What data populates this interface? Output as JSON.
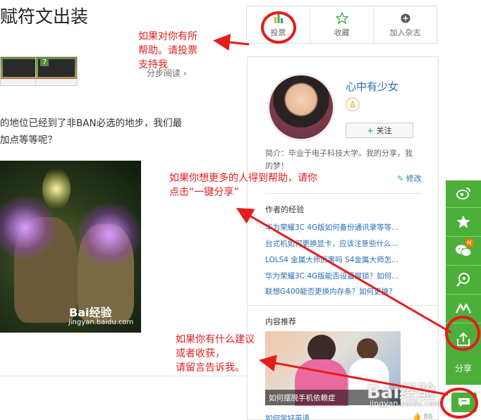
{
  "article": {
    "title": "赋符文出装",
    "step_read": "分步阅读 ›",
    "para1": "的地位已经到了非BAN必选的地步，我们最",
    "para2": "加点等等呢？",
    "thumb2_num": "7",
    "image_watermark": "Bai经验",
    "image_watermark_url": "jingyan.baidu.com"
  },
  "actions": {
    "vote": "投票",
    "favorite": "收藏",
    "add_magazine": "加入杂志"
  },
  "author": {
    "name": "心中有少女",
    "follow": "关注",
    "bio": "简介：毕业于电子科技大学。我的分享，我的梦！",
    "edit": "修改"
  },
  "experience": {
    "header": "作者的经验",
    "items": [
      "华为荣耀3C 4G版如何备份通讯录等等...",
      "台式机如何更换显卡，应该注意些什么...",
      "LOLS4 金属大师厉害吗 S4金属大师怎...",
      "华为荣耀3C 4G版能否设置屏锁？如何...",
      "联想G400能否更换内存条？如何更换？"
    ]
  },
  "recommend": {
    "header": "内容推荐",
    "caption": "如何摆脱手机依赖症",
    "next": "如何学好英语",
    "count": "86"
  },
  "share": {
    "label": "分享",
    "badge": "N",
    "icons": [
      "weibo-icon",
      "star-icon",
      "wechat-icon",
      "qq-icon",
      "renren-icon",
      "share-export-icon"
    ]
  },
  "annotations": {
    "vote_note": [
      "如果对你有所",
      "帮助。请投票",
      "支持我"
    ],
    "share_note": [
      "如果你想更多的人得到帮助，请你",
      "点击“一键分享”"
    ],
    "comment_note": [
      "如果你有什么建议",
      "或者收获，",
      "请留言告诉我。"
    ]
  },
  "watermark": {
    "brand": "Bai经验",
    "url": "jingyan.baidu.com"
  },
  "colors": {
    "link": "#2a6fb5",
    "share_green": "#4caf3a",
    "annotation_red": "#e51c1c"
  }
}
